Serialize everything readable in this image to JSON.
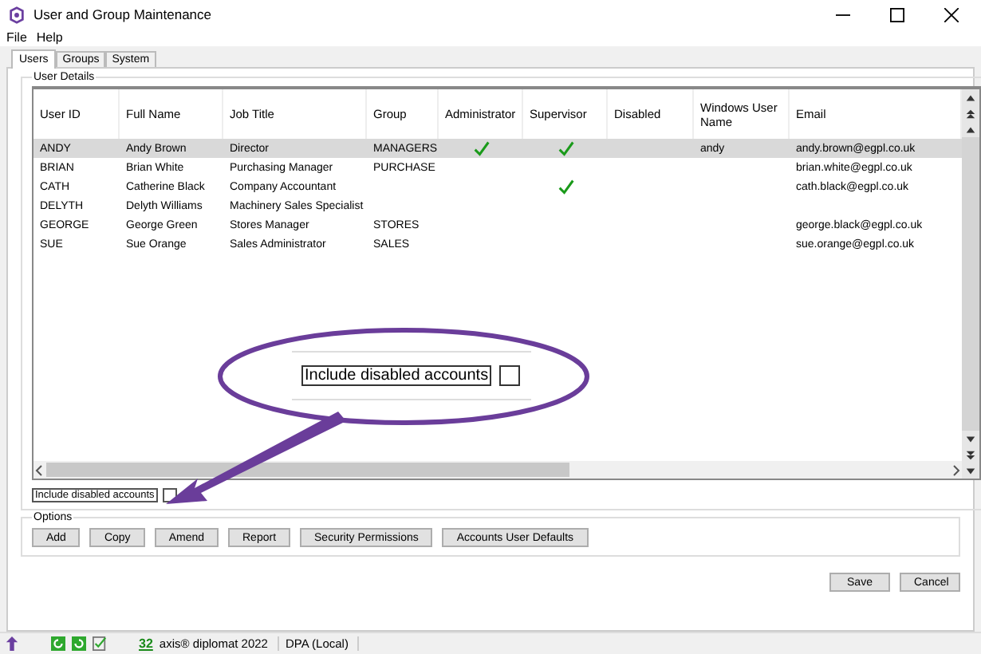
{
  "window": {
    "title": "User and Group Maintenance"
  },
  "menu": [
    "File",
    "Help"
  ],
  "tabs": [
    {
      "label": "Users",
      "selected": true
    },
    {
      "label": "Groups",
      "selected": false
    },
    {
      "label": "System",
      "selected": false
    }
  ],
  "user_details": {
    "title": "User Details",
    "table": {
      "columns": [
        "User ID",
        "Full Name",
        "Job Title",
        "Group",
        "Administrator",
        "Supervisor",
        "Disabled",
        "Windows User Name",
        "Email"
      ],
      "rows": [
        {
          "user_id": "ANDY",
          "full_name": "Andy Brown",
          "job_title": "Director",
          "group": "MANAGERS",
          "administrator": true,
          "supervisor": true,
          "disabled": false,
          "windows_user_name": "andy",
          "email": "andy.brown@egpl.co.uk",
          "selected": true
        },
        {
          "user_id": "BRIAN",
          "full_name": "Brian White",
          "job_title": "Purchasing Manager",
          "group": "PURCHASE",
          "administrator": false,
          "supervisor": false,
          "disabled": false,
          "windows_user_name": "",
          "email": "brian.white@egpl.co.uk",
          "selected": false
        },
        {
          "user_id": "CATH",
          "full_name": "Catherine Black",
          "job_title": "Company Accountant",
          "group": "",
          "administrator": false,
          "supervisor": true,
          "disabled": false,
          "windows_user_name": "",
          "email": "cath.black@egpl.co.uk",
          "selected": false
        },
        {
          "user_id": "DELYTH",
          "full_name": "Delyth Williams",
          "job_title": "Machinery Sales Specialist",
          "group": "",
          "administrator": false,
          "supervisor": false,
          "disabled": false,
          "windows_user_name": "",
          "email": "",
          "selected": false
        },
        {
          "user_id": "GEORGE",
          "full_name": "George Green",
          "job_title": "Stores Manager",
          "group": "STORES",
          "administrator": false,
          "supervisor": false,
          "disabled": false,
          "windows_user_name": "",
          "email": "george.black@egpl.co.uk",
          "selected": false
        },
        {
          "user_id": "SUE",
          "full_name": "Sue Orange",
          "job_title": "Sales Administrator",
          "group": "SALES",
          "administrator": false,
          "supervisor": false,
          "disabled": false,
          "windows_user_name": "",
          "email": "sue.orange@egpl.co.uk",
          "selected": false
        }
      ]
    },
    "include_disabled": {
      "label": "Include disabled accounts",
      "checked": false
    }
  },
  "callout": {
    "label": "Include disabled accounts",
    "checked": false
  },
  "options": {
    "title": "Options",
    "buttons": [
      "Add",
      "Copy",
      "Amend",
      "Report",
      "Security Permissions",
      "Accounts User Defaults"
    ]
  },
  "buttons": [
    "Save",
    "Cancel"
  ],
  "status_bar": {
    "count": "32",
    "product": "axis® diplomat 2022",
    "database": "DPA (Local)"
  }
}
